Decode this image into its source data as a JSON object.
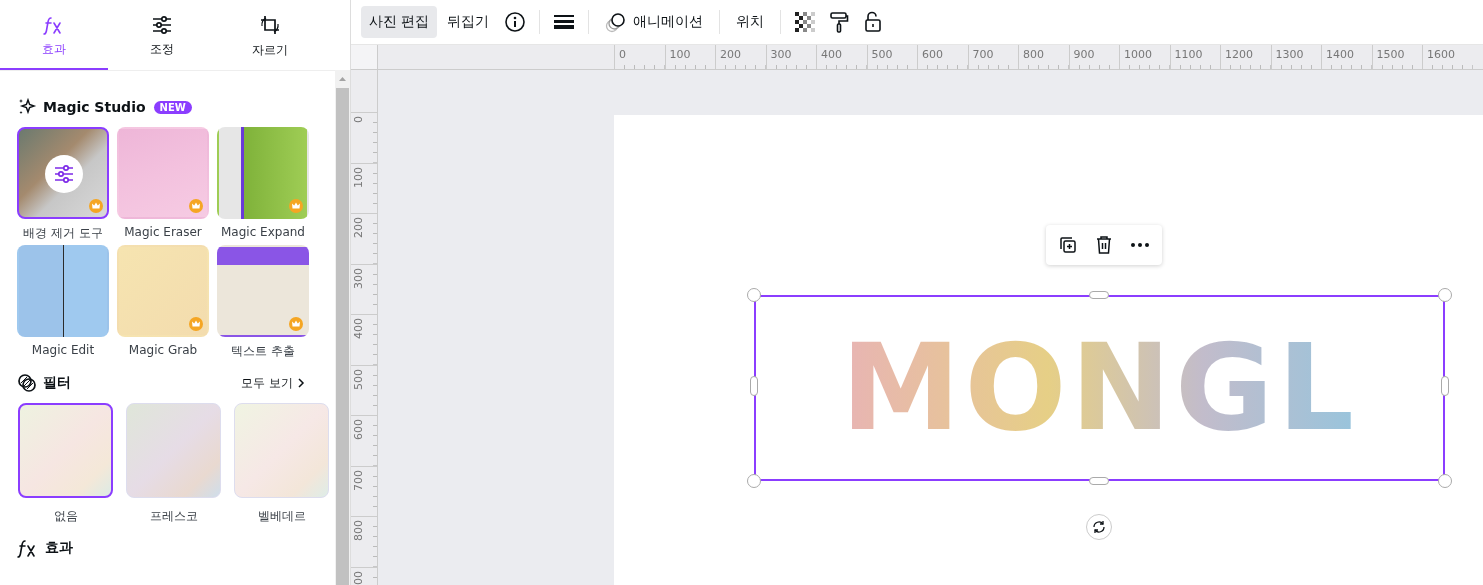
{
  "side_tabs": [
    {
      "label": "효과",
      "selected": true
    },
    {
      "label": "조정",
      "selected": false
    },
    {
      "label": "자르기",
      "selected": false
    }
  ],
  "magic_studio": {
    "title": "Magic Studio",
    "badge": "NEW",
    "tools": [
      {
        "label": "배경 제거 도구",
        "selected": true,
        "premium": true
      },
      {
        "label": "Magic Eraser",
        "selected": false,
        "premium": true
      },
      {
        "label": "Magic Expand",
        "selected": false,
        "premium": true
      },
      {
        "label": "Magic Edit",
        "selected": false,
        "premium": false
      },
      {
        "label": "Magic Grab",
        "selected": false,
        "premium": true
      },
      {
        "label": "텍스트 추출",
        "selected": false,
        "premium": true
      }
    ]
  },
  "filters": {
    "title": "필터",
    "see_all": "모두 보기",
    "items": [
      {
        "label": "없음",
        "selected": true
      },
      {
        "label": "프레스코",
        "selected": false
      },
      {
        "label": "벨베데르",
        "selected": false
      }
    ]
  },
  "effects": {
    "title": "효과"
  },
  "toolbar": {
    "buttons": [
      {
        "label": "사진 편집",
        "selected": true
      },
      {
        "label": "뒤집기",
        "selected": false
      }
    ],
    "animate": "애니메이션",
    "position": "위치"
  },
  "rulers": {
    "horizontal": [
      "0",
      "100",
      "200",
      "300",
      "400",
      "500",
      "600",
      "700",
      "800",
      "900",
      "1000",
      "1100",
      "1200",
      "1300",
      "1400",
      "1500",
      "1600"
    ],
    "vertical": [
      "0",
      "100",
      "200",
      "300",
      "400",
      "500",
      "600",
      "700",
      "800",
      "00"
    ]
  },
  "canvas": {
    "logo_text": "MONGL"
  }
}
